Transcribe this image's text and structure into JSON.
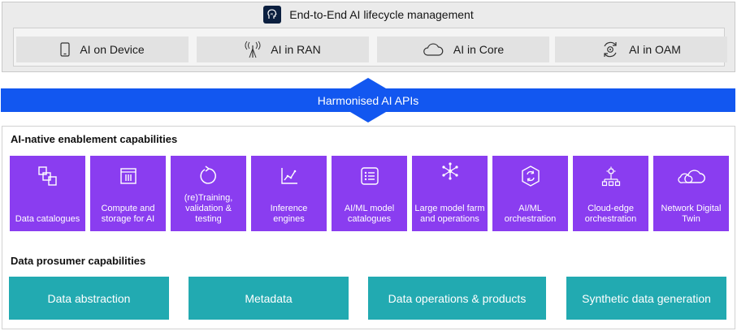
{
  "lifecycle": {
    "title": "End-to-End AI lifecycle management",
    "icon": "ai-head-icon",
    "tiles": [
      {
        "label": "AI on Device",
        "icon": "smartphone-icon"
      },
      {
        "label": "AI in RAN",
        "icon": "antenna-icon"
      },
      {
        "label": "AI in Core",
        "icon": "cloud-icon"
      },
      {
        "label": "AI in OAM",
        "icon": "gear-cycle-icon"
      }
    ]
  },
  "api": {
    "label": "Harmonised AI APIs"
  },
  "enablement": {
    "title": "AI-native enablement capabilities",
    "tiles": [
      {
        "label": "Data catalogues",
        "icon": "data-catalogue-icon"
      },
      {
        "label": "Compute and storage for AI",
        "icon": "compute-storage-icon"
      },
      {
        "label": "(re)Training, validation & testing",
        "icon": "retraining-icon"
      },
      {
        "label": "Inference engines",
        "icon": "inference-chart-icon"
      },
      {
        "label": "AI/ML model catalogues",
        "icon": "model-list-icon"
      },
      {
        "label": "Large model farm and operations",
        "icon": "network-nodes-icon"
      },
      {
        "label": "AI/ML orchestration",
        "icon": "orchestration-icon"
      },
      {
        "label": "Cloud-edge orchestration",
        "icon": "cloud-edge-icon"
      },
      {
        "label": "Network Digital Twin",
        "icon": "digital-twin-cloud-icon"
      }
    ]
  },
  "prosumer": {
    "title": "Data prosumer capabilities",
    "tiles": [
      {
        "label": "Data abstraction"
      },
      {
        "label": "Metadata"
      },
      {
        "label": "Data operations & products"
      },
      {
        "label": "Synthetic data generation"
      }
    ]
  },
  "colors": {
    "api_band": "#1257f0",
    "enablement_tile": "#8a3df0",
    "prosumer_tile": "#22aab1",
    "lifecycle_bg": "#ebebeb"
  }
}
